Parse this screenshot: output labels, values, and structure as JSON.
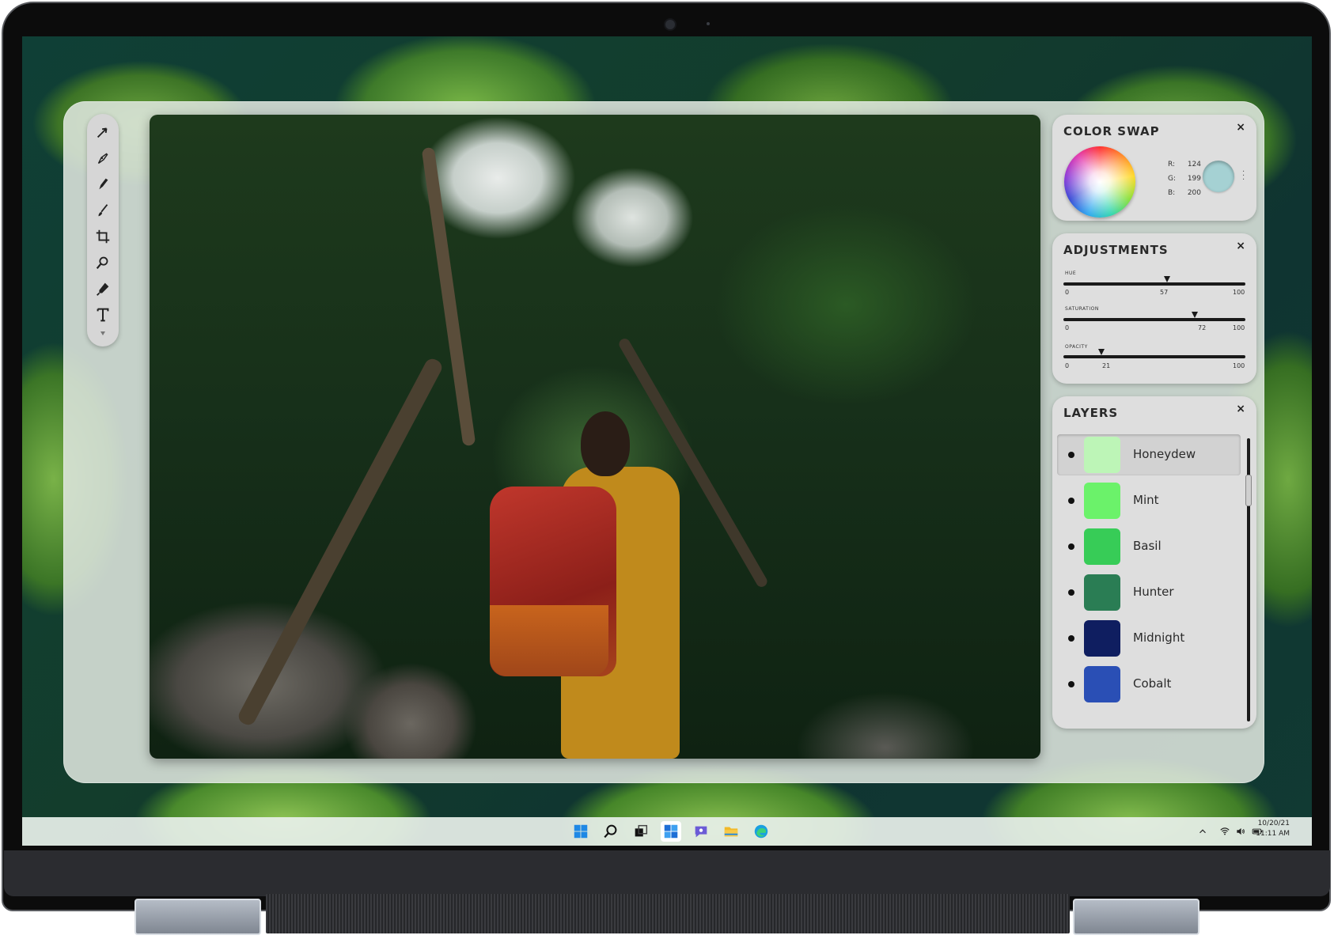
{
  "color_swap": {
    "title": "COLOR SWAP",
    "close": "×",
    "r_label": "R:",
    "r_value": "124",
    "g_label": "G:",
    "g_value": "199",
    "b_label": "B:",
    "b_value": "200",
    "swatch_color": "#a5d1d3"
  },
  "adjustments": {
    "title": "ADJUSTMENTS",
    "close": "×",
    "sliders": [
      {
        "label": "HUE",
        "min": "0",
        "value": "57",
        "max": "100"
      },
      {
        "label": "SATURATION",
        "min": "0",
        "value": "72",
        "max": "100"
      },
      {
        "label": "OPACITY",
        "min": "0",
        "value": "21",
        "max": "100"
      }
    ]
  },
  "layers": {
    "title": "LAYERS",
    "close": "×",
    "items": [
      {
        "name": "Honeydew",
        "color": "#bdf5b7",
        "selected": true
      },
      {
        "name": "Mint",
        "color": "#6bf26a",
        "selected": false
      },
      {
        "name": "Basil",
        "color": "#37cc57",
        "selected": false
      },
      {
        "name": "Hunter",
        "color": "#2a7d54",
        "selected": false
      },
      {
        "name": "Midnight",
        "color": "#0f1e60",
        "selected": false
      },
      {
        "name": "Cobalt",
        "color": "#2a4fb5",
        "selected": false
      }
    ]
  },
  "toolbar": {
    "tools": [
      "pointer-icon",
      "pen-tool-icon",
      "pencil-icon",
      "brush-icon",
      "crop-icon",
      "zoom-icon",
      "eyedropper-icon",
      "text-icon"
    ]
  },
  "taskbar": {
    "icons": [
      "windows-start-icon",
      "search-icon",
      "task-view-icon",
      "widgets-icon",
      "teams-chat-icon",
      "file-explorer-icon",
      "edge-browser-icon"
    ],
    "date": "10/20/21",
    "time": "11:11 AM"
  }
}
